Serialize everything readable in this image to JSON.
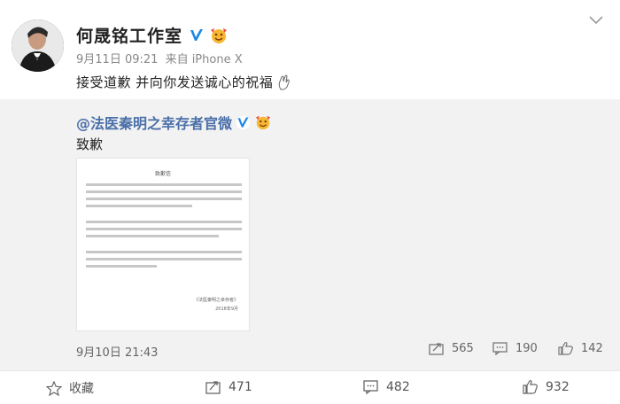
{
  "post": {
    "author": "何晟铭工作室",
    "time": "9月11日 09:21",
    "source": "来自 iPhone X",
    "text": "接受道歉 并向你发送诚心的祝福"
  },
  "repost": {
    "author": "@法医秦明之幸存者官微",
    "text": "致歉",
    "letter_title": "致歉信",
    "letter_sign": "《法医秦明之幸存者》",
    "letter_date": "2018年9月",
    "time": "9月10日 21:43",
    "forwards": "565",
    "comments": "190",
    "likes": "142"
  },
  "actions": {
    "favorite": "收藏",
    "forward": "471",
    "comment": "482",
    "like": "932"
  },
  "icons": {
    "verified": "verified-v-icon",
    "vip": "vip-emoji-icon",
    "hand": "praying-hand-icon",
    "menu": "chevron-down-icon",
    "star": "star-icon",
    "share": "share-icon",
    "comment": "comment-icon",
    "like": "thumbs-up-icon"
  },
  "colors": {
    "verified": "#f5a623",
    "link": "#4a6fa8",
    "repost_bg": "#f2f2f2"
  }
}
